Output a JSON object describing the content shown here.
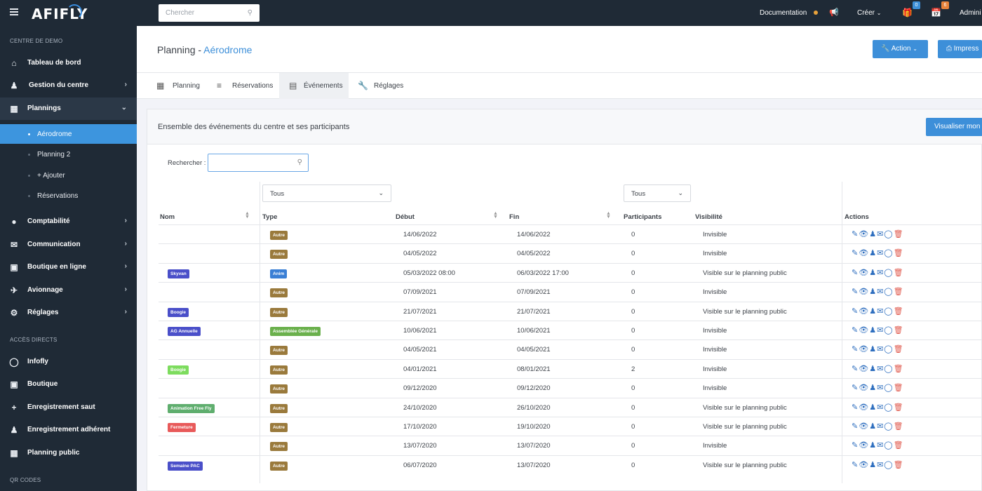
{
  "topbar": {
    "logo": "AFIFLY",
    "search_placeholder": "Chercher",
    "documentation": "Documentation",
    "create": "Créer",
    "gift_badge": "0",
    "calendar_badge": "6",
    "admin": "Admini"
  },
  "sidebar": {
    "section1": "CENTRE DE DEMO",
    "items": [
      {
        "label": "Tableau de bord",
        "icon": "home-icon"
      },
      {
        "label": "Gestion du centre",
        "icon": "users-icon"
      },
      {
        "label": "Plannings",
        "icon": "calendar-icon"
      }
    ],
    "subitems": [
      "Aérodrome",
      "Planning 2",
      "+ Ajouter",
      "Réservations"
    ],
    "items2": [
      {
        "label": "Comptabilité",
        "icon": "piggy-bank-icon"
      },
      {
        "label": "Communication",
        "icon": "mail-icon"
      },
      {
        "label": "Boutique en ligne",
        "icon": "store-icon"
      },
      {
        "label": "Avionnage",
        "icon": "plane-icon"
      },
      {
        "label": "Réglages",
        "icon": "gear-icon"
      }
    ],
    "section2": "ACCÈS DIRECTS",
    "direct": [
      {
        "label": "Infofly",
        "icon": "chat-icon"
      },
      {
        "label": "Boutique",
        "icon": "store-icon"
      },
      {
        "label": "Enregistrement saut",
        "icon": "plus-icon"
      },
      {
        "label": "Enregistrement adhérent",
        "icon": "user-add-icon"
      },
      {
        "label": "Planning public",
        "icon": "calendar-icon"
      }
    ],
    "section3": "QR CODES"
  },
  "header": {
    "title": "Planning",
    "sep": " - ",
    "subtitle": "Aérodrome",
    "action": "Action",
    "print": "Impress"
  },
  "tabs": [
    "Planning",
    "Réservations",
    "Événements",
    "Réglages"
  ],
  "card": {
    "title": "Ensemble des événements du centre et ses participants",
    "visualize": "Visualiser mon p",
    "search_label": "Rechercher :",
    "filter_type": "Tous",
    "filter_participants": "Tous"
  },
  "table": {
    "headers": [
      "Nom",
      "Type",
      "Début",
      "Fin",
      "Participants",
      "Visibilité",
      "Actions"
    ],
    "rows": [
      {
        "nom": "",
        "nom_color": "",
        "type": "Autre",
        "type_color": "#9a7a3c",
        "debut": "14/06/2022",
        "fin": "14/06/2022",
        "participants": "0",
        "visibilite": "Invisible"
      },
      {
        "nom": "",
        "nom_color": "",
        "type": "Autre",
        "type_color": "#9a7a3c",
        "debut": "04/05/2022",
        "fin": "04/05/2022",
        "participants": "0",
        "visibilite": "Invisible"
      },
      {
        "nom": "Skyvan",
        "nom_color": "#4a4fc9",
        "type": "Anim",
        "type_color": "#3a7fd5",
        "debut": "05/03/2022 08:00",
        "fin": "06/03/2022 17:00",
        "participants": "0",
        "visibilite": "Visible sur le planning public"
      },
      {
        "nom": "",
        "nom_color": "",
        "type": "Autre",
        "type_color": "#9a7a3c",
        "debut": "07/09/2021",
        "fin": "07/09/2021",
        "participants": "0",
        "visibilite": "Invisible"
      },
      {
        "nom": "Boogie",
        "nom_color": "#4a4fc9",
        "type": "Autre",
        "type_color": "#9a7a3c",
        "debut": "21/07/2021",
        "fin": "21/07/2021",
        "participants": "0",
        "visibilite": "Visible sur le planning public"
      },
      {
        "nom": "AG Annuelle",
        "nom_color": "#4a4fc9",
        "type": "Assemblée Générale",
        "type_color": "#6ab04c",
        "debut": "10/06/2021",
        "fin": "10/06/2021",
        "participants": "0",
        "visibilite": "Invisible"
      },
      {
        "nom": "",
        "nom_color": "",
        "type": "Autre",
        "type_color": "#9a7a3c",
        "debut": "04/05/2021",
        "fin": "04/05/2021",
        "participants": "0",
        "visibilite": "Invisible"
      },
      {
        "nom": "Boogie",
        "nom_color": "#7ddc5e",
        "type": "Autre",
        "type_color": "#9a7a3c",
        "debut": "04/01/2021",
        "fin": "08/01/2021",
        "participants": "2",
        "visibilite": "Invisible"
      },
      {
        "nom": "",
        "nom_color": "",
        "type": "Autre",
        "type_color": "#9a7a3c",
        "debut": "09/12/2020",
        "fin": "09/12/2020",
        "participants": "0",
        "visibilite": "Invisible"
      },
      {
        "nom": "Animation Free Fly",
        "nom_color": "#5fae6e",
        "type": "Autre",
        "type_color": "#9a7a3c",
        "debut": "24/10/2020",
        "fin": "26/10/2020",
        "participants": "0",
        "visibilite": "Visible sur le planning public"
      },
      {
        "nom": "Fermeture",
        "nom_color": "#e85a5a",
        "type": "Autre",
        "type_color": "#9a7a3c",
        "debut": "17/10/2020",
        "fin": "19/10/2020",
        "participants": "0",
        "visibilite": "Visible sur le planning public"
      },
      {
        "nom": "",
        "nom_color": "",
        "type": "Autre",
        "type_color": "#9a7a3c",
        "debut": "13/07/2020",
        "fin": "13/07/2020",
        "participants": "0",
        "visibilite": "Invisible"
      },
      {
        "nom": "Semaine PAC",
        "nom_color": "#4a4fc9",
        "type": "Autre",
        "type_color": "#9a7a3c",
        "debut": "06/07/2020",
        "fin": "13/07/2020",
        "participants": "0",
        "visibilite": "Visible sur le planning public"
      }
    ]
  },
  "colors": {
    "accent": "#3d8fd9",
    "sidebar": "#1f2a36",
    "delete": "#e05a4e",
    "action_icons": "#2f6fbf"
  }
}
